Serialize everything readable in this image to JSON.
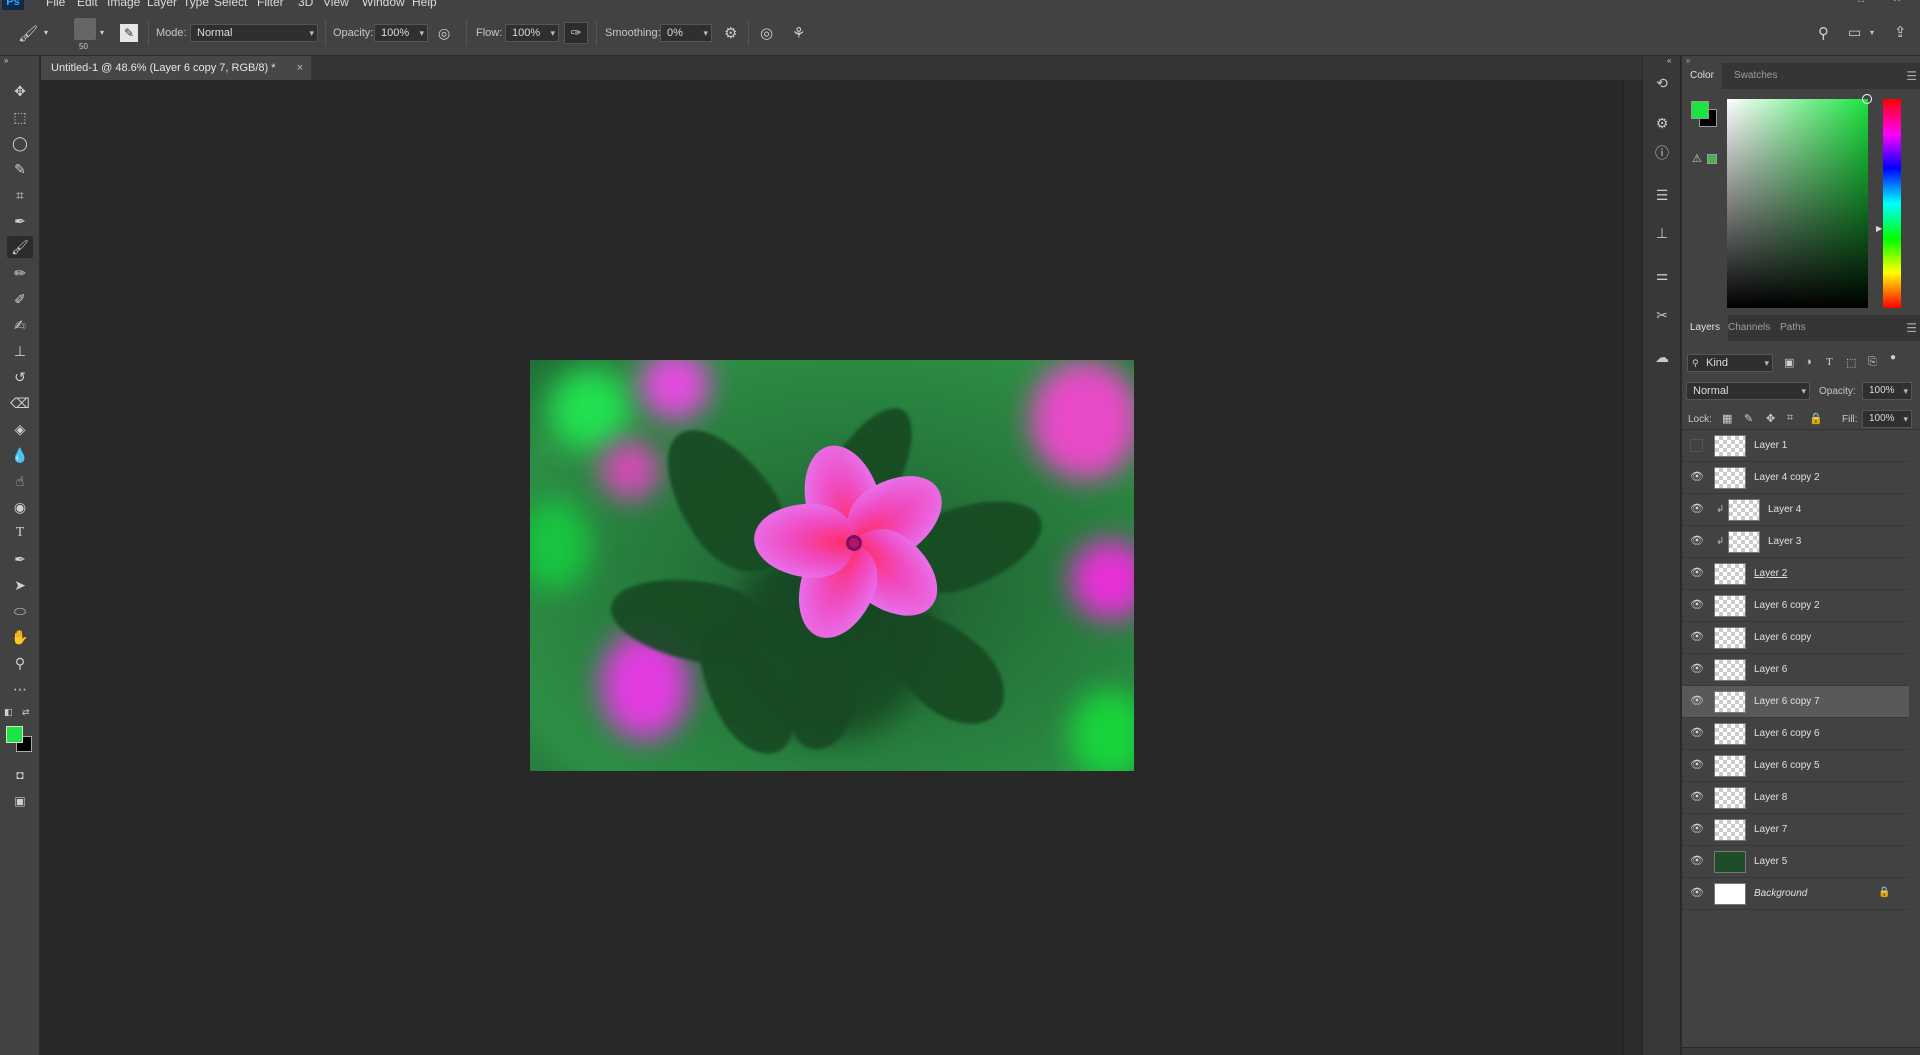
{
  "app": {
    "logo": "Ps"
  },
  "menu": [
    "File",
    "Edit",
    "Image",
    "Layer",
    "Type",
    "Select",
    "Filter",
    "3D",
    "View",
    "Window",
    "Help"
  ],
  "options": {
    "brush_size": "50",
    "mode_label": "Mode:",
    "mode_value": "Normal",
    "opacity_label": "Opacity:",
    "opacity_value": "100%",
    "flow_label": "Flow:",
    "flow_value": "100%",
    "smoothing_label": "Smoothing:",
    "smoothing_value": "0%"
  },
  "document": {
    "tab_title": "Untitled-1 @ 48.6% (Layer 6 copy 7, RGB/8) *",
    "close": "×"
  },
  "colors": {
    "foreground": "#1be33f",
    "background": "#000000",
    "accent": "#31a8ff"
  },
  "color_panel": {
    "tabs": [
      "Color",
      "Swatches"
    ],
    "active_tab": "Color"
  },
  "layers_panel": {
    "tabs": [
      "Layers",
      "Channels",
      "Paths"
    ],
    "active_tab": "Layers",
    "filter": "Kind",
    "blend_mode": "Normal",
    "opacity_label": "Opacity:",
    "opacity_value": "100%",
    "lock_label": "Lock:",
    "fill_label": "Fill:",
    "fill_value": "100%",
    "layers": [
      {
        "name": "Layer 1",
        "visible": false,
        "clipped": false,
        "selected": false
      },
      {
        "name": "Layer 4 copy 2",
        "visible": true,
        "clipped": false,
        "selected": false
      },
      {
        "name": "Layer 4",
        "visible": true,
        "clipped": true,
        "selected": false
      },
      {
        "name": "Layer 3",
        "visible": true,
        "clipped": true,
        "selected": false
      },
      {
        "name": "Layer 2",
        "visible": true,
        "clipped": false,
        "selected": false
      },
      {
        "name": "Layer 6 copy 2",
        "visible": true,
        "clipped": false,
        "selected": false
      },
      {
        "name": "Layer 6 copy",
        "visible": true,
        "clipped": false,
        "selected": false
      },
      {
        "name": "Layer 6",
        "visible": true,
        "clipped": false,
        "selected": false
      },
      {
        "name": "Layer 6 copy 7",
        "visible": true,
        "clipped": false,
        "selected": true
      },
      {
        "name": "Layer 6 copy 6",
        "visible": true,
        "clipped": false,
        "selected": false
      },
      {
        "name": "Layer 6 copy 5",
        "visible": true,
        "clipped": false,
        "selected": false
      },
      {
        "name": "Layer 8",
        "visible": true,
        "clipped": false,
        "selected": false
      },
      {
        "name": "Layer 7",
        "visible": true,
        "clipped": false,
        "selected": false
      },
      {
        "name": "Layer 5",
        "visible": true,
        "clipped": false,
        "selected": false
      },
      {
        "name": "Background",
        "visible": true,
        "clipped": false,
        "selected": false,
        "locked": true
      }
    ]
  }
}
